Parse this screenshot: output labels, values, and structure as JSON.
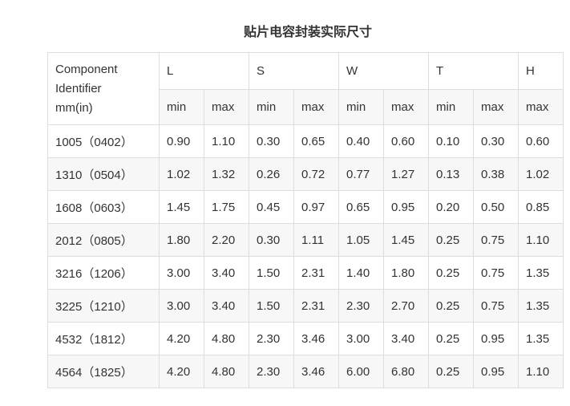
{
  "title": "贴片电容封装实际尺寸",
  "table": {
    "ident_header": [
      "Component",
      "Identifier",
      "mm(in)"
    ],
    "groups": [
      "L",
      "S",
      "W",
      "T",
      "H"
    ],
    "sub": [
      "min",
      "max",
      "min",
      "max",
      "min",
      "max",
      "min",
      "max",
      "max"
    ],
    "rows": [
      [
        "1005（0402）",
        "0.90",
        "1.10",
        "0.30",
        "0.65",
        "0.40",
        "0.60",
        "0.10",
        "0.30",
        "0.60"
      ],
      [
        "1310（0504）",
        "1.02",
        "1.32",
        "0.26",
        "0.72",
        "0.77",
        "1.27",
        "0.13",
        "0.38",
        "1.02"
      ],
      [
        "1608（0603）",
        "1.45",
        "1.75",
        "0.45",
        "0.97",
        "0.65",
        "0.95",
        "0.20",
        "0.50",
        "0.85"
      ],
      [
        "2012（0805）",
        "1.80",
        "2.20",
        "0.30",
        "1.11",
        "1.05",
        "1.45",
        "0.25",
        "0.75",
        "1.10"
      ],
      [
        "3216（1206）",
        "3.00",
        "3.40",
        "1.50",
        "2.31",
        "1.40",
        "1.80",
        "0.25",
        "0.75",
        "1.35"
      ],
      [
        "3225（1210）",
        "3.00",
        "3.40",
        "1.50",
        "2.31",
        "2.30",
        "2.70",
        "0.25",
        "0.75",
        "1.35"
      ],
      [
        "4532（1812）",
        "4.20",
        "4.80",
        "2.30",
        "3.46",
        "3.00",
        "3.40",
        "0.25",
        "0.95",
        "1.35"
      ],
      [
        "4564（1825）",
        "4.20",
        "4.80",
        "2.30",
        "3.46",
        "6.00",
        "6.80",
        "0.25",
        "0.95",
        "1.10"
      ]
    ]
  }
}
